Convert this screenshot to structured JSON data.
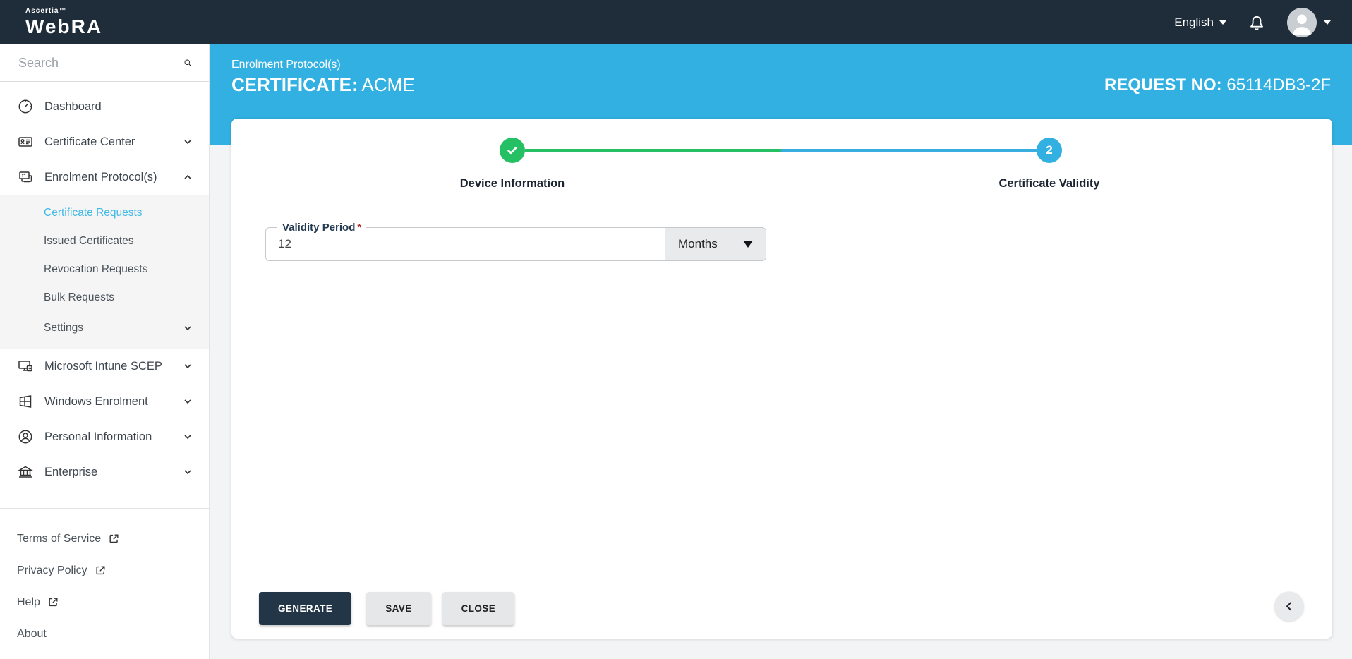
{
  "colors": {
    "header_bg": "#1f2c3a",
    "accent_blue": "#31b0e1",
    "progress_green": "#25c064",
    "link_blue": "#41b9e6",
    "dark_button": "#233648"
  },
  "header": {
    "brand_small": "Ascertia™",
    "brand_large": "WebRA",
    "language": "English"
  },
  "sidebar": {
    "search_placeholder": "Search",
    "items_top": [
      {
        "label": "Dashboard",
        "icon": "dashboard-icon"
      },
      {
        "label": "Certificate Center",
        "icon": "certificate-center-icon",
        "chevron": "down"
      },
      {
        "label": "Enrolment Protocol(s)",
        "icon": "enrolment-protocols-icon",
        "chevron": "up"
      }
    ],
    "submenu": [
      {
        "label": "Certificate Requests",
        "active": true
      },
      {
        "label": "Issued Certificates"
      },
      {
        "label": "Revocation Requests"
      },
      {
        "label": "Bulk Requests"
      },
      {
        "label": "Settings",
        "chevron": "down"
      }
    ],
    "items_bottom": [
      {
        "label": "Microsoft Intune SCEP",
        "icon": "intune-scep-icon",
        "chevron": "down"
      },
      {
        "label": "Windows Enrolment",
        "icon": "windows-icon",
        "chevron": "down"
      },
      {
        "label": "Personal Information",
        "icon": "person-icon",
        "chevron": "down"
      },
      {
        "label": "Enterprise",
        "icon": "bank-icon",
        "chevron": "down"
      }
    ],
    "footer_links": [
      {
        "label": "Terms of Service",
        "external": true
      },
      {
        "label": "Privacy Policy",
        "external": true
      },
      {
        "label": "Help",
        "external": true
      },
      {
        "label": "About",
        "external": false
      }
    ]
  },
  "banner": {
    "breadcrumb": "Enrolment Protocol(s)",
    "title_label": "CERTIFICATE:",
    "title_value": "ACME",
    "request_label": "REQUEST NO:",
    "request_value": "65114DB3-2F"
  },
  "wizard": {
    "steps": [
      {
        "label": "Device Information",
        "state": "completed"
      },
      {
        "label": "Certificate Validity",
        "state": "active",
        "number": "2"
      }
    ]
  },
  "form": {
    "validity_label": "Validity Period",
    "required_marker": "*",
    "validity_value": "12",
    "unit_value": "Months"
  },
  "footer": {
    "generate_label": "GENERATE",
    "save_label": "SAVE",
    "close_label": "CLOSE"
  }
}
